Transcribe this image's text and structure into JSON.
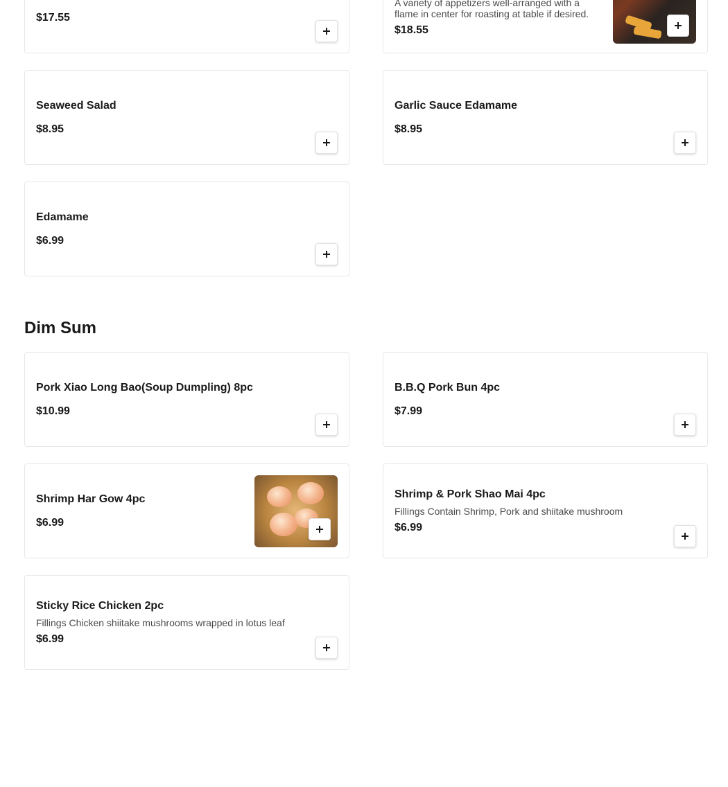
{
  "appetizers": [
    {
      "name": "",
      "description": "",
      "price": "$17.55"
    },
    {
      "name": "",
      "description": "A variety of appetizers well-arranged with a flame in center for roasting at table if desired.",
      "price": "$18.55",
      "has_image": true
    },
    {
      "name": "Seaweed Salad",
      "price": "$8.95"
    },
    {
      "name": "Garlic Sauce Edamame",
      "price": "$8.95"
    },
    {
      "name": "Edamame",
      "price": "$6.99"
    }
  ],
  "dim_sum": {
    "section_title": "Dim Sum",
    "items": [
      {
        "name": "Pork Xiao Long Bao(Soup Dumpling) 8pc",
        "price": "$10.99"
      },
      {
        "name": "B.B.Q Pork Bun 4pc",
        "price": "$7.99"
      },
      {
        "name": "Shrimp Har Gow 4pc",
        "price": "$6.99",
        "has_image": true
      },
      {
        "name": "Shrimp & Pork Shao Mai 4pc",
        "description": "Fillings Contain Shrimp, Pork and shiitake mushroom",
        "price": "$6.99"
      },
      {
        "name": "Sticky Rice Chicken 2pc",
        "description": "Fillings Chicken shiitake mushrooms wrapped in lotus leaf",
        "price": "$6.99"
      }
    ]
  },
  "icons": {
    "add": "plus-icon"
  }
}
